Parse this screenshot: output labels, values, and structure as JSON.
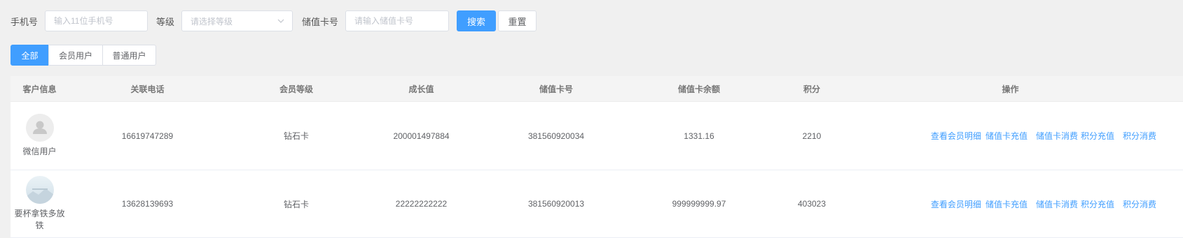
{
  "filters": {
    "phone_label": "手机号",
    "phone_placeholder": "输入11位手机号",
    "level_label": "等级",
    "level_placeholder": "请选择等级",
    "card_label": "储值卡号",
    "card_placeholder": "请输入储值卡号",
    "search_button": "搜索",
    "reset_button": "重置"
  },
  "tabs": [
    "全部",
    "会员用户",
    "普通用户"
  ],
  "active_tab": "全部",
  "table": {
    "headers": [
      "客户信息",
      "关联电话",
      "会员等级",
      "成长值",
      "储值卡号",
      "储值卡余额",
      "积分",
      "操作"
    ],
    "rows": [
      {
        "name": "微信用户",
        "phone": "16619747289",
        "level": "钻石卡",
        "growth": "200001497884",
        "card_no": "381560920034",
        "balance": "1331.16",
        "points": "2210",
        "ops": [
          "查看会员明细",
          "储值卡充值",
          "储值卡消费",
          "积分充值",
          "积分消费"
        ]
      },
      {
        "name": "要杯拿铁多放铁",
        "phone": "13628139693",
        "level": "钻石卡",
        "growth": "22222222222",
        "card_no": "381560920013",
        "balance": "999999999.97",
        "points": "403023",
        "ops": [
          "查看会员明细",
          "储值卡充值",
          "储值卡消费",
          "积分充值",
          "积分消费"
        ]
      }
    ]
  },
  "colors": {
    "primary": "#409eff",
    "background": "#f0f0f0"
  },
  "icons": {
    "avatar_default": "user-silhouette-icon",
    "avatar_photo": "landscape-photo-icon",
    "select_arrow": "chevron-down-icon"
  }
}
